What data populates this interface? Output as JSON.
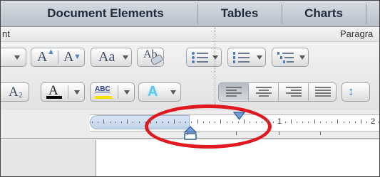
{
  "tabs": [
    {
      "label": "Document Elements"
    },
    {
      "label": "Tables"
    },
    {
      "label": "Charts"
    }
  ],
  "sections": {
    "font_label": "nt",
    "paragraph_label": "Paragra"
  },
  "font_buttons": {
    "grow_font": "A",
    "shrink_font": "A",
    "change_case": "Aa",
    "clear_format": "Ab",
    "subscript": "A",
    "subscript_small": "2",
    "font_color": "A",
    "highlight": "ABC",
    "text_effects": "A"
  },
  "ruler": {
    "labels": [
      "1",
      "2"
    ]
  },
  "colors": {
    "ring": "#e0181f",
    "font_color_bar": "#000000",
    "highlight_bar": "#ffe100"
  }
}
